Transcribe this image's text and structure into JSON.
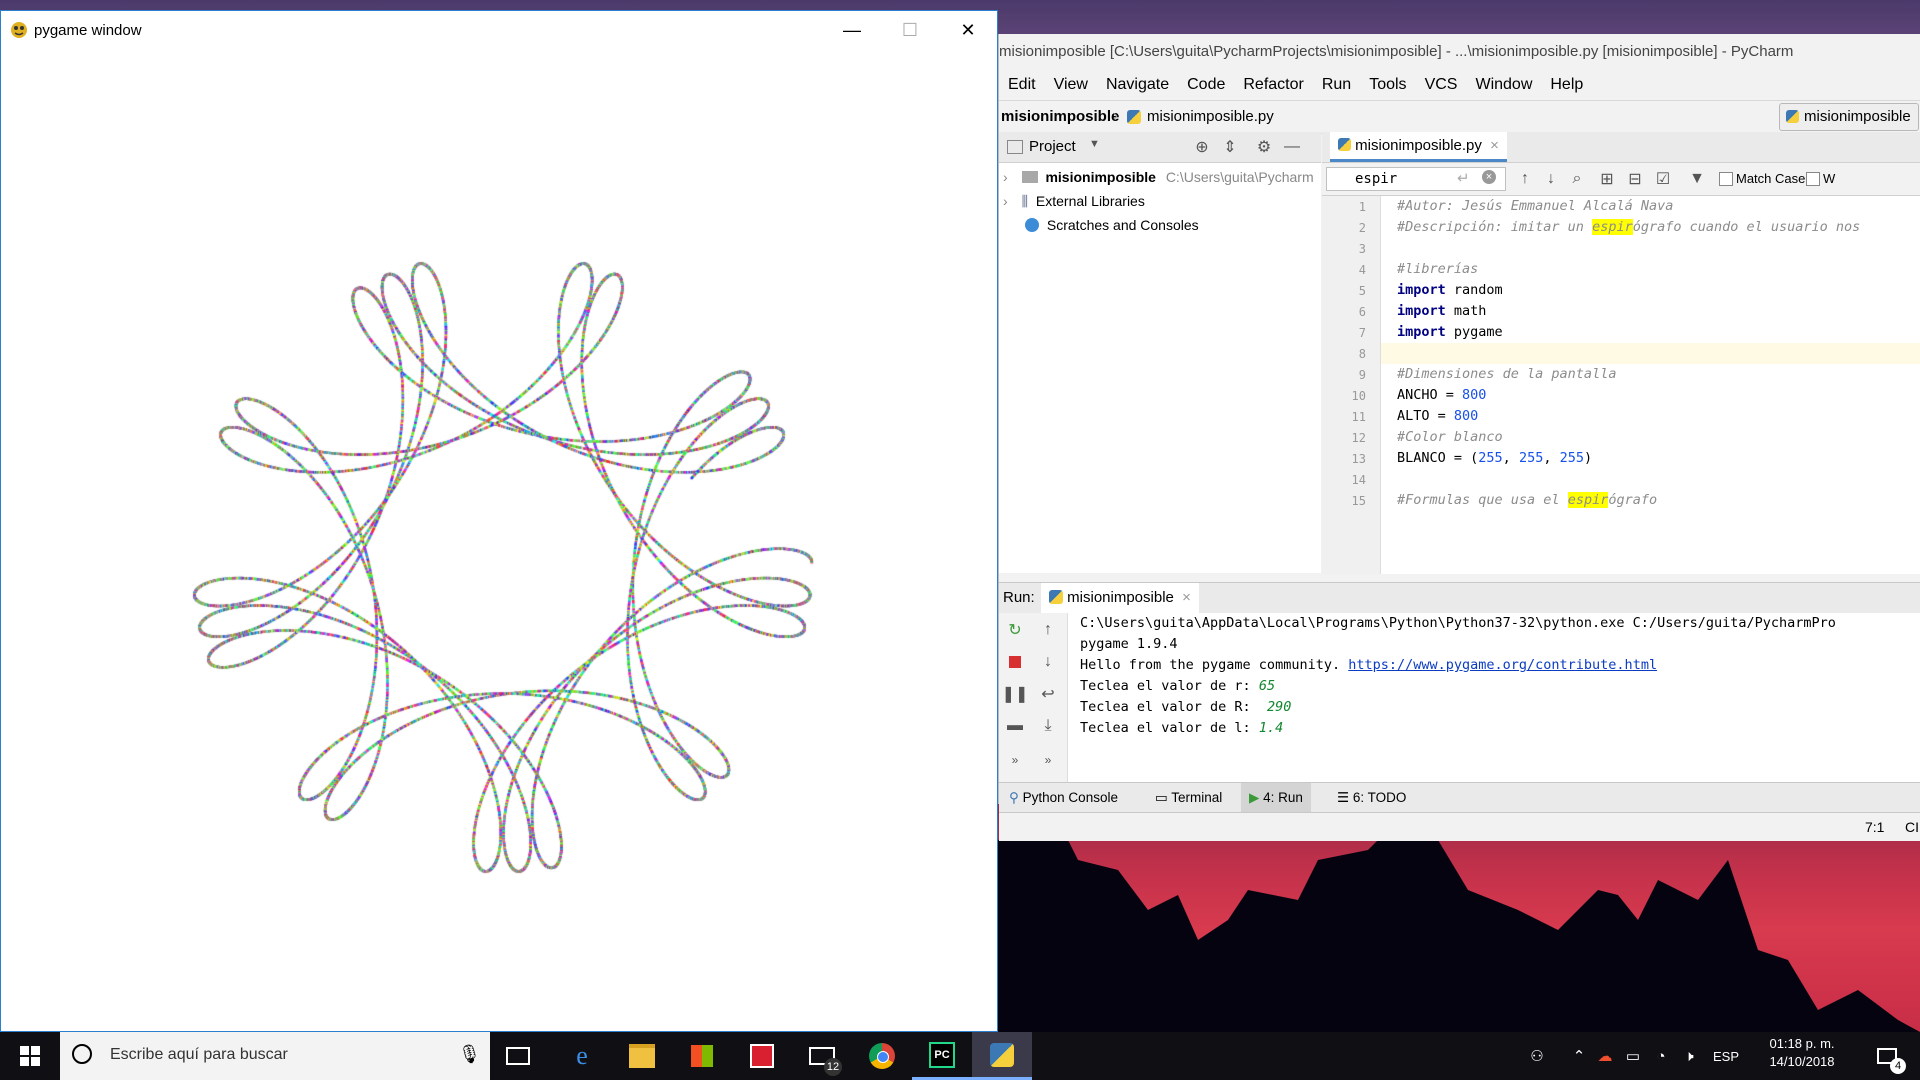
{
  "pygame_window": {
    "title": "pygame window",
    "controls": {
      "minimize": "—",
      "maximize": "☐",
      "close": "✕"
    },
    "spirograph": {
      "r": 65,
      "R": 290,
      "l": 1.4,
      "background": "#ffffff"
    }
  },
  "pycharm": {
    "title": "misionimposible [C:\\Users\\guita\\PycharmProjects\\misionimposible] - ...\\misionimposible.py [misionimposible] - PyCharm",
    "menu": [
      "Edit",
      "View",
      "Navigate",
      "Code",
      "Refactor",
      "Run",
      "Tools",
      "VCS",
      "Window",
      "Help"
    ],
    "breadcrumb": {
      "project": "misionimposible",
      "file": "misionimposible.py"
    },
    "run_config": "misionimposible",
    "project_panel": {
      "title": "Project",
      "items": [
        {
          "name": "misionimposible",
          "path": "C:\\Users\\guita\\Pycharm"
        },
        {
          "name": "External Libraries"
        },
        {
          "name": "Scratches and Consoles"
        }
      ]
    },
    "editor_tab": "misionimposible.py",
    "search": {
      "value": "espir",
      "match_case_label": "Match Case",
      "words_label": "W"
    },
    "code": {
      "line_numbers": [
        "1",
        "2",
        "3",
        "4",
        "5",
        "6",
        "7",
        "8",
        "9",
        "10",
        "11",
        "12",
        "13",
        "14",
        "15"
      ],
      "lines": {
        "l1": "#Autor: Jesús Emmanuel Alcalá Nava",
        "l2a": "#Descripción: imitar un ",
        "l2hl": "espir",
        "l2b": "ógrafo cuando el usuario nos",
        "l4": "#librerías",
        "kw_import": "import",
        "l5": " random",
        "l6": " math",
        "l7": " pygame",
        "l9": "#Dimensiones de la pantalla",
        "l10a": "ANCHO = ",
        "l10n": "800",
        "l11a": "ALTO = ",
        "l11n": "800",
        "l12": "#Color blanco",
        "l13a": "BLANCO = (",
        "l13n1": "255",
        "l13s1": ", ",
        "l13n2": "255",
        "l13s2": ", ",
        "l13n3": "255",
        "l13c": ")",
        "l15a": "#Formulas que usa el ",
        "l15hl": "espir",
        "l15b": "ógrafo"
      }
    },
    "run": {
      "label": "Run:",
      "tab": "misionimposible",
      "console": {
        "cmd": "C:\\Users\\guita\\AppData\\Local\\Programs\\Python\\Python37-32\\python.exe C:/Users/guita/PycharmPro",
        "version": "pygame 1.9.4",
        "hello": "Hello from the pygame community. ",
        "link": "https://www.pygame.org/contribute.html",
        "p1": "Teclea el valor de r: ",
        "v1": "65",
        "p2": "Teclea el valor de R: ",
        "v2": " 290",
        "p3": "Teclea el valor de l: ",
        "v3": "1.4"
      }
    },
    "bottom_tabs": [
      "Python Console",
      "Terminal",
      "4: Run",
      "6: TODO"
    ],
    "status": {
      "position": "7:1",
      "extra": "CI"
    }
  },
  "taskbar": {
    "search_placeholder": "Escribe aquí para buscar",
    "mail_badge": "12",
    "language": "ESP",
    "time": "01:18 p. m.",
    "date": "14/10/2018",
    "notifications": "4"
  },
  "colors": {
    "pycharm_bg": "#f2f2f2",
    "taskbar": "#101014",
    "window_border": "#2a7fd0",
    "sunset": "#d83a4e"
  }
}
